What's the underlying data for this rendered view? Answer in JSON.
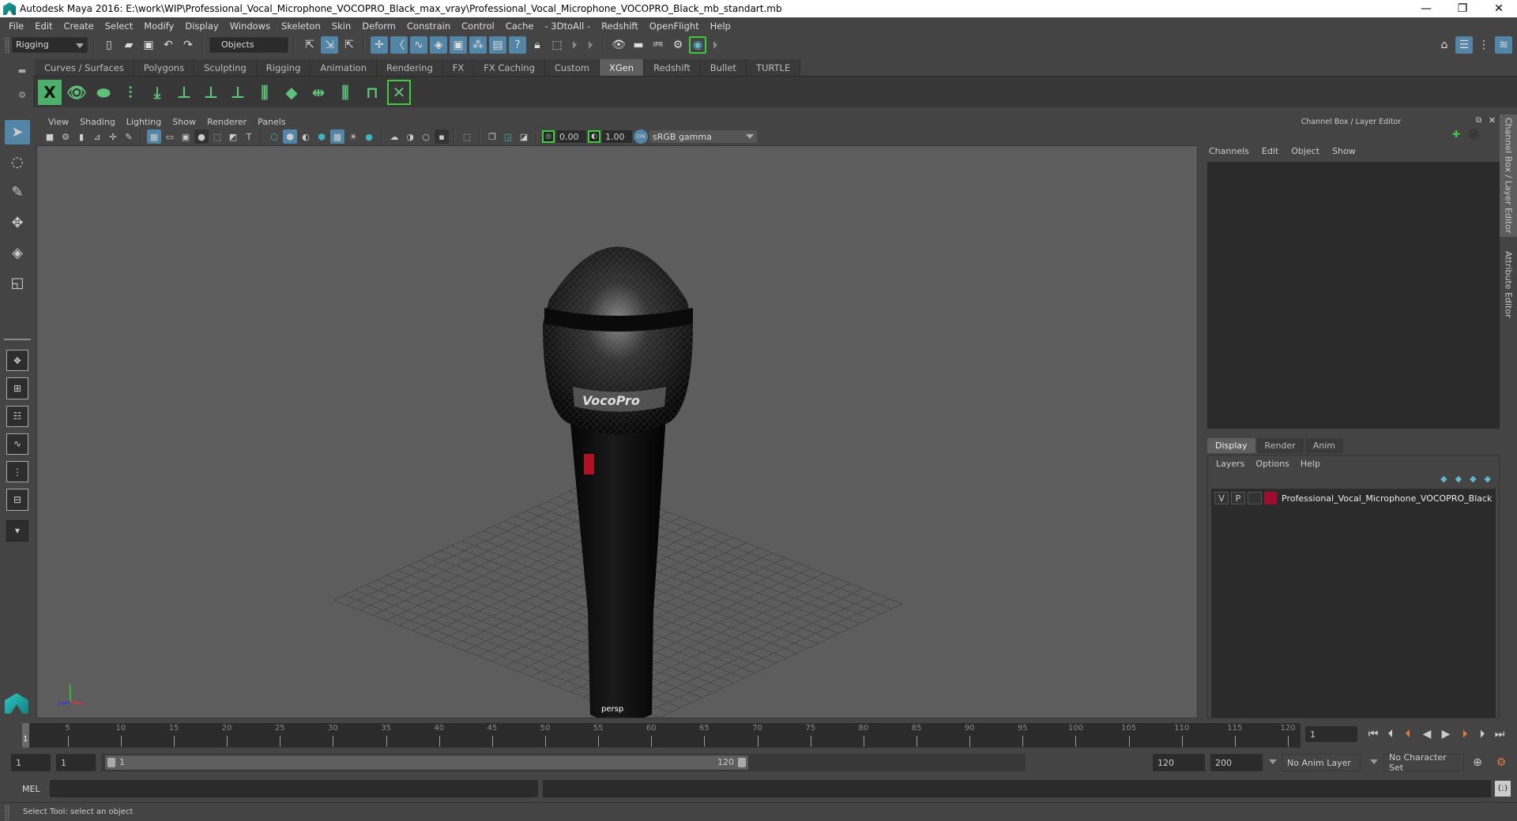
{
  "window": {
    "title": "Autodesk Maya 2016: E:\\work\\WIP\\Professional_Vocal_Microphone_VOCOPRO_Black_max_vray\\Professional_Vocal_Microphone_VOCOPRO_Black_mb_standart.mb",
    "minimize": "—",
    "restore": "❐",
    "close": "✕"
  },
  "menubar": [
    "File",
    "Edit",
    "Create",
    "Select",
    "Modify",
    "Display",
    "Windows",
    "Skeleton",
    "Skin",
    "Deform",
    "Constrain",
    "Control",
    "Cache",
    "- 3DtoAll -",
    "Redshift",
    "OpenFlight",
    "Help"
  ],
  "statusline": {
    "menuset": "Rigging",
    "selection_mode": "Objects"
  },
  "shelf": {
    "tabs": [
      "Curves / Surfaces",
      "Polygons",
      "Sculpting",
      "Rigging",
      "Animation",
      "Rendering",
      "FX",
      "FX Caching",
      "Custom",
      "XGen",
      "Redshift",
      "Bullet",
      "TURTLE"
    ],
    "active_tab": "XGen",
    "icons": [
      "xgen-editor-icon",
      "toggle-preview-icon",
      "hide-preview-icon",
      "add-guides-icon",
      "place-guides-icon",
      "add-guide-icon",
      "show-guides-icon",
      "lock-guides-icon",
      "guides-split-icon",
      "flatten-guides-icon",
      "bend-guides-icon",
      "select-guides-icon",
      "guide-bounds-icon",
      "xgen-clear-icon"
    ]
  },
  "viewport": {
    "menu": [
      "View",
      "Shading",
      "Lighting",
      "Show",
      "Renderer",
      "Panels"
    ],
    "exposure": "0.00",
    "gamma": "1.00",
    "color_mgmt_toggle": "ON",
    "color_space": "sRGB gamma",
    "camera_label": "persp",
    "axis": {
      "x": "x",
      "y": "y",
      "z": "z"
    },
    "model_brand_text": "VocoPro"
  },
  "right_panel": {
    "title": "Channel Box / Layer Editor",
    "channel_menu": [
      "Channels",
      "Edit",
      "Object",
      "Show"
    ],
    "layer_tabs": [
      "Display",
      "Render",
      "Anim"
    ],
    "active_layer_tab": "Display",
    "layer_menu": [
      "Layers",
      "Options",
      "Help"
    ],
    "layers": [
      {
        "v": "V",
        "p": "P",
        "name": "Professional_Vocal_Microphone_VOCOPRO_Black",
        "color": "#a00c30"
      }
    ],
    "side_tabs": [
      "Channel Box / Layer Editor",
      "Attribute Editor"
    ]
  },
  "timeline": {
    "ticks": [
      5,
      10,
      15,
      20,
      25,
      30,
      35,
      40,
      45,
      50,
      55,
      60,
      65,
      70,
      75,
      80,
      85,
      90,
      95,
      100,
      105,
      110,
      115,
      120
    ],
    "start": 1,
    "end": 120,
    "current_frame": "1",
    "current_marker": "1"
  },
  "range": {
    "start_time": "1",
    "playback_start": "1",
    "slider_start": "1",
    "slider_end": "120",
    "playback_end": "120",
    "end_time": "200",
    "anim_layer": "No Anim Layer",
    "character_set": "No Character Set"
  },
  "mel": {
    "label": "MEL",
    "input": ""
  },
  "help_line": "Select Tool: select an object",
  "colors": {
    "accent": "#5285a6",
    "layer_color": "#a00c30",
    "green_highlight": "#3ccc3c",
    "playback_orange": "#e07a3a"
  }
}
